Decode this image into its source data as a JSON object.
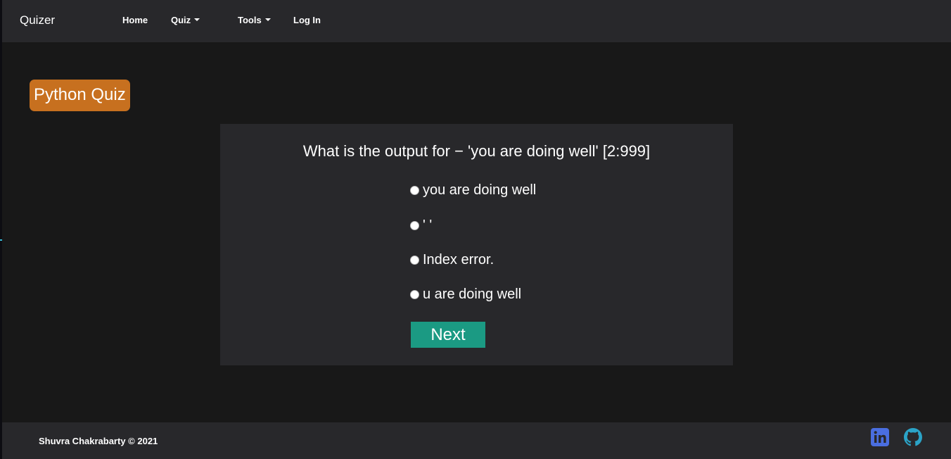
{
  "navbar": {
    "brand": "Quizer",
    "links": [
      {
        "label": "Home"
      },
      {
        "label": "Quiz",
        "dropdown": true
      },
      {
        "label": "Tools",
        "dropdown": true
      },
      {
        "label": "Log In"
      }
    ]
  },
  "quiz": {
    "title": "Python Quiz",
    "question": "What is the output for − 'you are doing well' [2:999]",
    "options": [
      {
        "label": "you are doing well"
      },
      {
        "label": "' '"
      },
      {
        "label": "Index error."
      },
      {
        "label": "u are doing well"
      }
    ],
    "next_label": "Next"
  },
  "footer": {
    "copyright": "Shuvra Chakrabarty © 2021",
    "social": [
      {
        "icon": "linkedin-icon",
        "color": "#4a6ee0"
      },
      {
        "icon": "github-icon",
        "color": "#2ba3c7"
      }
    ]
  },
  "colors": {
    "background": "#181818",
    "surface": "#28282b",
    "badge": "#c7701f",
    "next_button": "#1b9a83"
  }
}
